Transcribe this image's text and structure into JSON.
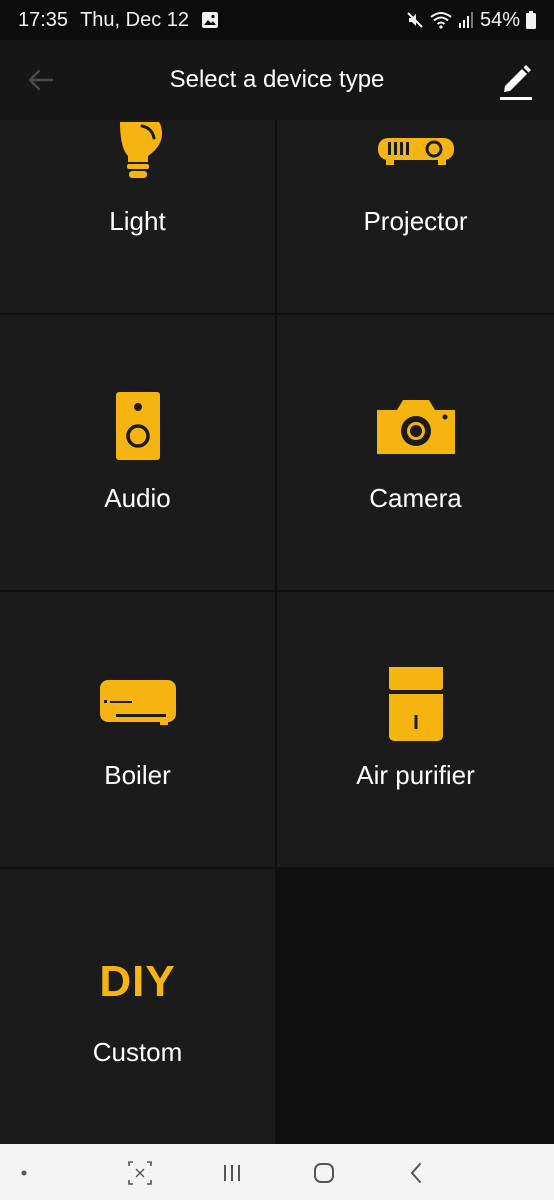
{
  "status_bar": {
    "time": "17:35",
    "date": "Thu, Dec 12",
    "battery": "54%",
    "icons": [
      "gallery-icon",
      "mute-icon",
      "wifi-icon",
      "signal-icon",
      "battery-icon"
    ]
  },
  "app_bar": {
    "title": "Select a device type",
    "back_icon": "back-arrow-icon",
    "edit_icon": "edit-pencil-icon"
  },
  "devices": [
    {
      "label": "Light",
      "icon": "light-bulb-icon"
    },
    {
      "label": "Projector",
      "icon": "projector-icon"
    },
    {
      "label": "Audio",
      "icon": "speaker-icon"
    },
    {
      "label": "Camera",
      "icon": "camera-icon"
    },
    {
      "label": "Boiler",
      "icon": "boiler-icon"
    },
    {
      "label": "Air purifier",
      "icon": "air-purifier-icon"
    },
    {
      "label": "Custom",
      "badge": "DIY"
    }
  ],
  "colors": {
    "accent": "#f5b40f",
    "tile": "#1b1b1b",
    "background": "#101010",
    "app_bar": "#161616"
  },
  "nav_bar": {
    "items": [
      "dot-icon",
      "screenshot-icon",
      "recents-icon",
      "home-icon",
      "back-icon"
    ]
  }
}
